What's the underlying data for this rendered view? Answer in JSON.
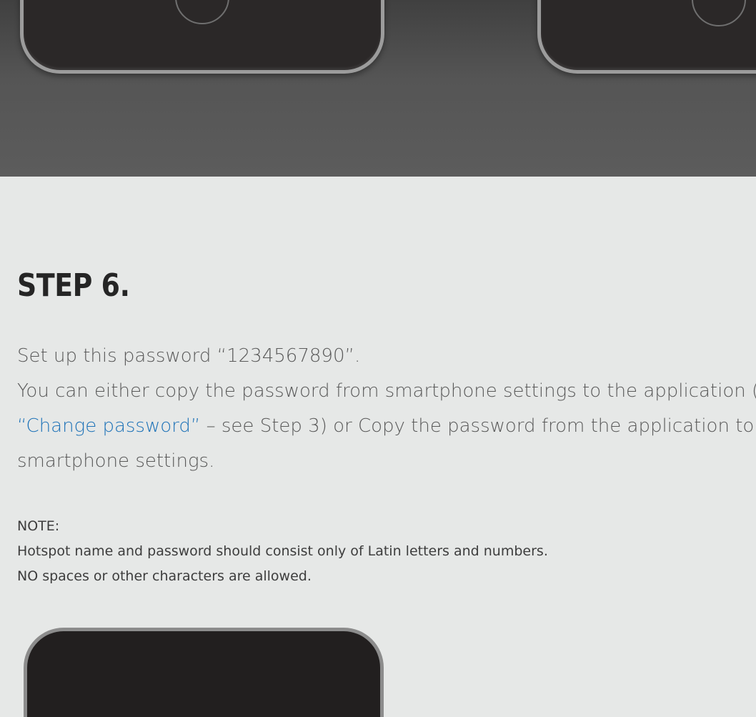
{
  "step": {
    "title": "STEP 6.",
    "line1": "Set up this password “1234567890”.",
    "line2": "You can either copy the password from smartphone settings to the application (",
    "link_text": "“Change password”",
    "line3_rest": " – see Step 3) or Copy the password from the application to",
    "line4": "smartphone settings."
  },
  "note": {
    "label": "NOTE:",
    "line1": "Hotspot name and password should consist only of Latin letters and numbers.",
    "line2": "NO spaces or other characters are allowed."
  },
  "colors": {
    "link": "#1f73b8",
    "heading": "#252525",
    "background": "#e6e8e7",
    "top_band": "#5c5c5c"
  }
}
